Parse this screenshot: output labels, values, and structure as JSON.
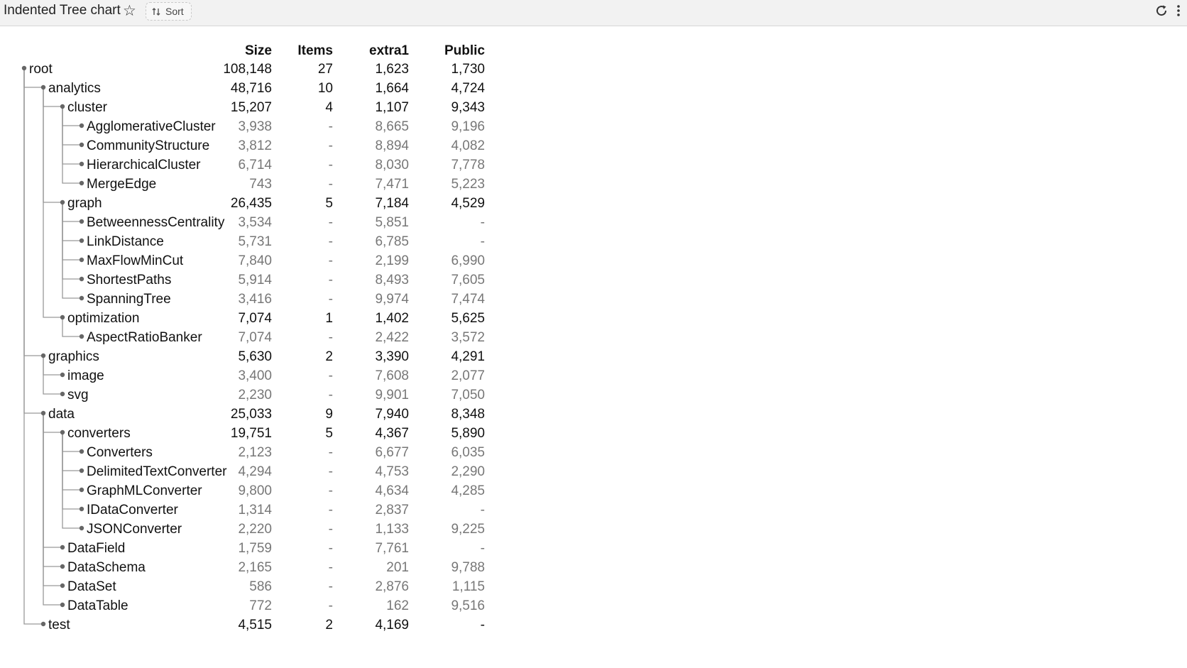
{
  "toolbar": {
    "title": "Indented Tree chart",
    "sort_label": "Sort",
    "icons": [
      "star-icon",
      "sort-icon",
      "refresh-icon",
      "more-icon"
    ]
  },
  "table": {
    "columns": [
      "Size",
      "Items",
      "extra1",
      "Public"
    ],
    "rows": [
      {
        "name": "root",
        "depth": 0,
        "leaf": false,
        "last": false,
        "values": [
          "108,148",
          "27",
          "1,623",
          "1,730"
        ]
      },
      {
        "name": "analytics",
        "depth": 1,
        "leaf": false,
        "last": false,
        "values": [
          "48,716",
          "10",
          "1,664",
          "4,724"
        ]
      },
      {
        "name": "cluster",
        "depth": 2,
        "leaf": false,
        "last": false,
        "values": [
          "15,207",
          "4",
          "1,107",
          "9,343"
        ]
      },
      {
        "name": "AgglomerativeCluster",
        "depth": 3,
        "leaf": true,
        "last": false,
        "values": [
          "3,938",
          "-",
          "8,665",
          "9,196"
        ]
      },
      {
        "name": "CommunityStructure",
        "depth": 3,
        "leaf": true,
        "last": false,
        "values": [
          "3,812",
          "-",
          "8,894",
          "4,082"
        ]
      },
      {
        "name": "HierarchicalCluster",
        "depth": 3,
        "leaf": true,
        "last": false,
        "values": [
          "6,714",
          "-",
          "8,030",
          "7,778"
        ]
      },
      {
        "name": "MergeEdge",
        "depth": 3,
        "leaf": true,
        "last": true,
        "values": [
          "743",
          "-",
          "7,471",
          "5,223"
        ]
      },
      {
        "name": "graph",
        "depth": 2,
        "leaf": false,
        "last": false,
        "values": [
          "26,435",
          "5",
          "7,184",
          "4,529"
        ]
      },
      {
        "name": "BetweennessCentrality",
        "depth": 3,
        "leaf": true,
        "last": false,
        "values": [
          "3,534",
          "-",
          "5,851",
          "-"
        ]
      },
      {
        "name": "LinkDistance",
        "depth": 3,
        "leaf": true,
        "last": false,
        "values": [
          "5,731",
          "-",
          "6,785",
          "-"
        ]
      },
      {
        "name": "MaxFlowMinCut",
        "depth": 3,
        "leaf": true,
        "last": false,
        "values": [
          "7,840",
          "-",
          "2,199",
          "6,990"
        ]
      },
      {
        "name": "ShortestPaths",
        "depth": 3,
        "leaf": true,
        "last": false,
        "values": [
          "5,914",
          "-",
          "8,493",
          "7,605"
        ]
      },
      {
        "name": "SpanningTree",
        "depth": 3,
        "leaf": true,
        "last": true,
        "values": [
          "3,416",
          "-",
          "9,974",
          "7,474"
        ]
      },
      {
        "name": "optimization",
        "depth": 2,
        "leaf": false,
        "last": true,
        "values": [
          "7,074",
          "1",
          "1,402",
          "5,625"
        ]
      },
      {
        "name": "AspectRatioBanker",
        "depth": 3,
        "leaf": true,
        "last": true,
        "values": [
          "7,074",
          "-",
          "2,422",
          "3,572"
        ]
      },
      {
        "name": "graphics",
        "depth": 1,
        "leaf": false,
        "last": false,
        "values": [
          "5,630",
          "2",
          "3,390",
          "4,291"
        ]
      },
      {
        "name": "image",
        "depth": 2,
        "leaf": true,
        "last": false,
        "values": [
          "3,400",
          "-",
          "7,608",
          "2,077"
        ]
      },
      {
        "name": "svg",
        "depth": 2,
        "leaf": true,
        "last": true,
        "values": [
          "2,230",
          "-",
          "9,901",
          "7,050"
        ]
      },
      {
        "name": "data",
        "depth": 1,
        "leaf": false,
        "last": false,
        "values": [
          "25,033",
          "9",
          "7,940",
          "8,348"
        ]
      },
      {
        "name": "converters",
        "depth": 2,
        "leaf": false,
        "last": false,
        "values": [
          "19,751",
          "5",
          "4,367",
          "5,890"
        ]
      },
      {
        "name": "Converters",
        "depth": 3,
        "leaf": true,
        "last": false,
        "values": [
          "2,123",
          "-",
          "6,677",
          "6,035"
        ]
      },
      {
        "name": "DelimitedTextConverter",
        "depth": 3,
        "leaf": true,
        "last": false,
        "values": [
          "4,294",
          "-",
          "4,753",
          "2,290"
        ]
      },
      {
        "name": "GraphMLConverter",
        "depth": 3,
        "leaf": true,
        "last": false,
        "values": [
          "9,800",
          "-",
          "4,634",
          "4,285"
        ]
      },
      {
        "name": "IDataConverter",
        "depth": 3,
        "leaf": true,
        "last": false,
        "values": [
          "1,314",
          "-",
          "2,837",
          "-"
        ]
      },
      {
        "name": "JSONConverter",
        "depth": 3,
        "leaf": true,
        "last": true,
        "values": [
          "2,220",
          "-",
          "1,133",
          "9,225"
        ]
      },
      {
        "name": "DataField",
        "depth": 2,
        "leaf": true,
        "last": false,
        "values": [
          "1,759",
          "-",
          "7,761",
          "-"
        ]
      },
      {
        "name": "DataSchema",
        "depth": 2,
        "leaf": true,
        "last": false,
        "values": [
          "2,165",
          "-",
          "201",
          "9,788"
        ]
      },
      {
        "name": "DataSet",
        "depth": 2,
        "leaf": true,
        "last": false,
        "values": [
          "586",
          "-",
          "2,876",
          "1,115"
        ]
      },
      {
        "name": "DataTable",
        "depth": 2,
        "leaf": true,
        "last": true,
        "values": [
          "772",
          "-",
          "162",
          "9,516"
        ]
      },
      {
        "name": "test",
        "depth": 1,
        "leaf": false,
        "last": true,
        "values": [
          "4,515",
          "2",
          "4,169",
          "-"
        ]
      }
    ]
  }
}
